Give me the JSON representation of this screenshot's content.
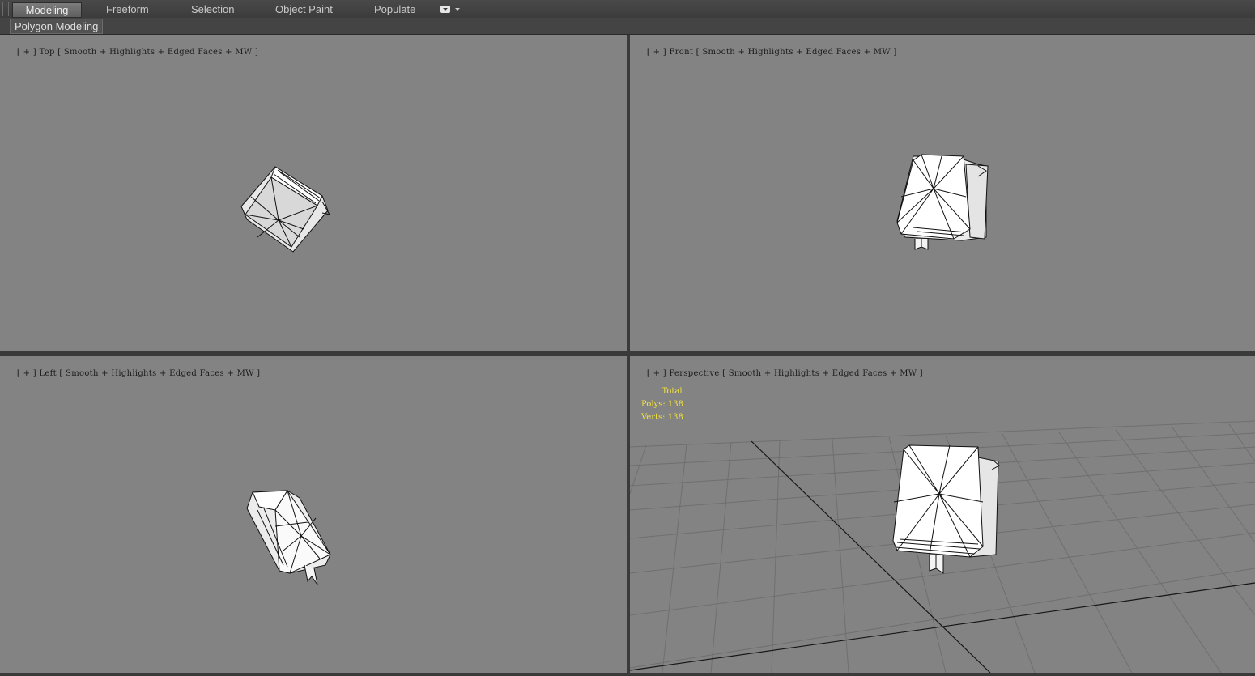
{
  "ribbon": {
    "tabs": [
      {
        "label": "Modeling",
        "active": true
      },
      {
        "label": "Freeform"
      },
      {
        "label": "Selection"
      },
      {
        "label": "Object Paint"
      },
      {
        "label": "Populate"
      }
    ],
    "options_icon": "dropdown-menu-icon",
    "panel_label": "Polygon Modeling"
  },
  "viewports": {
    "top": {
      "plus": "[ + ]",
      "view": "Top",
      "shading": "Smooth + Highlights + Edged Faces + MW ]",
      "sep": "[",
      "sep2": "["
    },
    "front": {
      "plus": "[ + ]",
      "view": "Front",
      "shading": "Smooth + Highlights + Edged Faces + MW ]",
      "sep": "[",
      "sep2": "["
    },
    "left": {
      "plus": "[ + ]",
      "view": "Left",
      "shading": "Smooth + Highlights + Edged Faces + MW ]",
      "sep": "[",
      "sep2": "["
    },
    "perspective": {
      "plus": "[ + ]",
      "view": "Perspective",
      "shading": "Smooth + Highlights + Edged Faces + MW ]",
      "sep": "[",
      "sep2": "["
    }
  },
  "stats": {
    "header": "Total",
    "polys_label": "Polys:",
    "polys_value": "138",
    "verts_label": "Verts:",
    "verts_value": "138",
    "color": "#f2e23c"
  },
  "colors": {
    "viewport_bg": "#838383",
    "ui_bg": "#3a3a3a"
  }
}
